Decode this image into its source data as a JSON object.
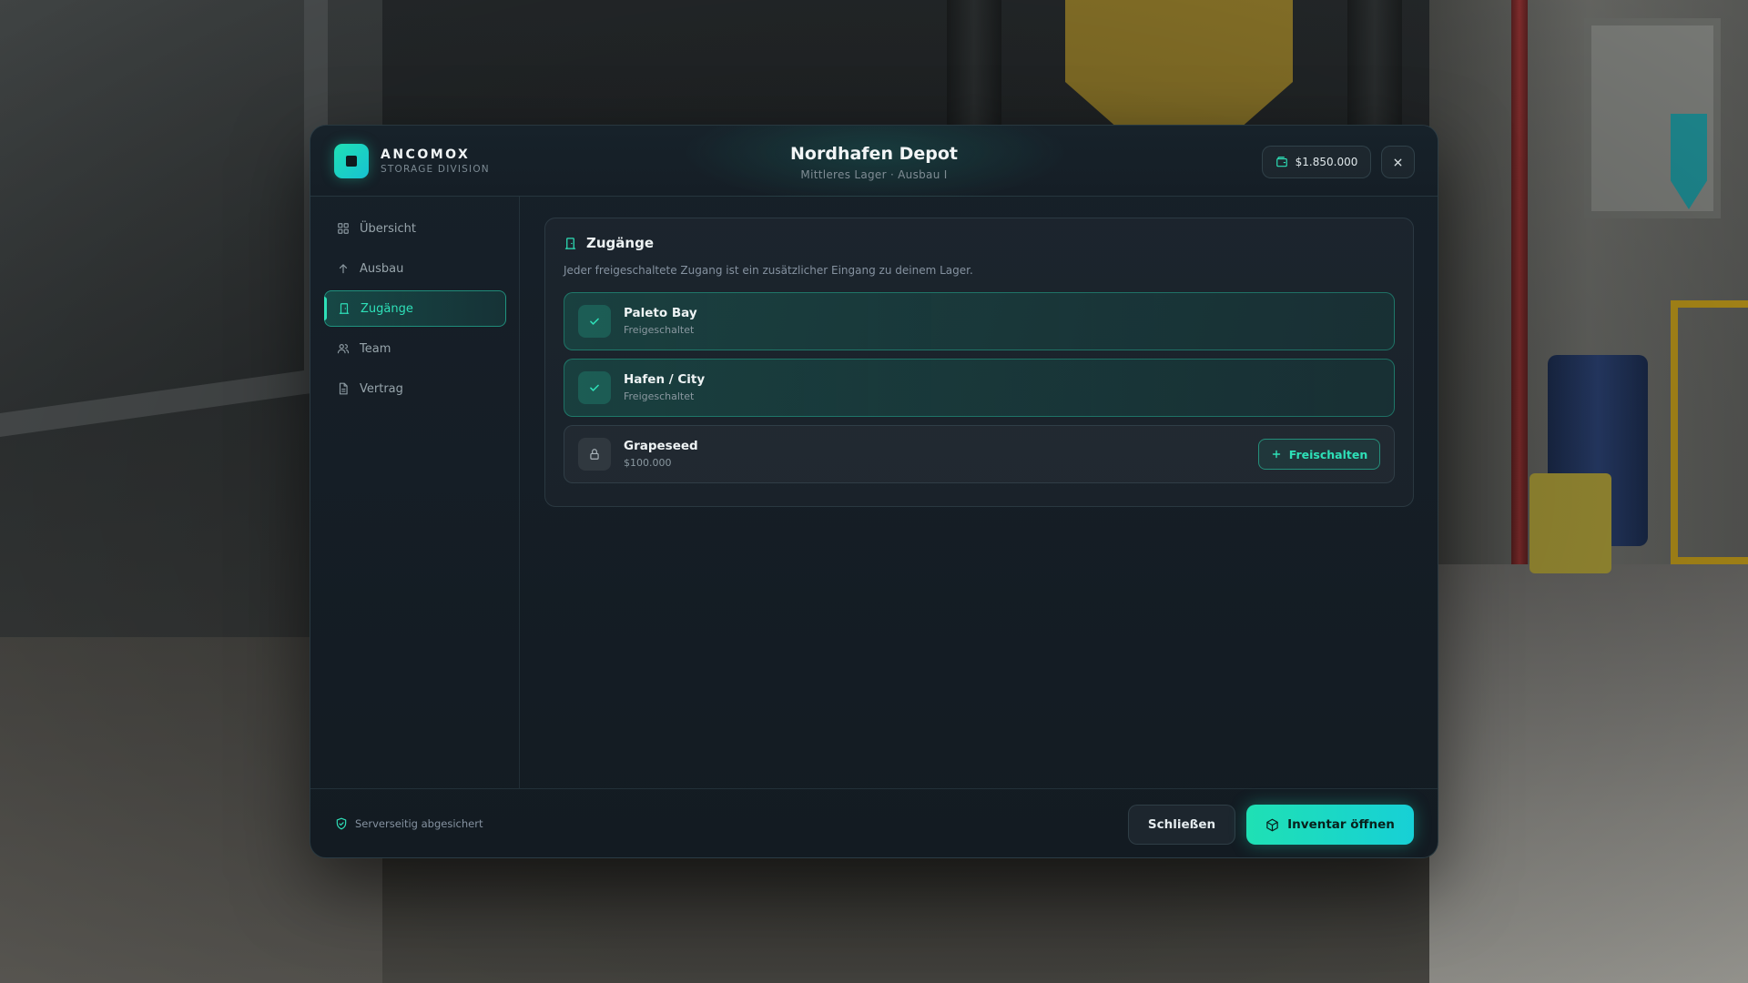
{
  "brand": {
    "name": "ANCOMOX",
    "subtitle": "STORAGE DIVISION"
  },
  "header": {
    "title": "Nordhafen Depot",
    "subtitle": "Mittleres Lager · Ausbau I",
    "balance": "$1.850.000"
  },
  "sidebar": {
    "items": [
      {
        "label": "Übersicht",
        "icon": "grid-icon"
      },
      {
        "label": "Ausbau",
        "icon": "arrow-up-icon"
      },
      {
        "label": "Zugänge",
        "icon": "door-icon",
        "active": true
      },
      {
        "label": "Team",
        "icon": "users-icon"
      },
      {
        "label": "Vertrag",
        "icon": "document-icon"
      }
    ]
  },
  "access": {
    "title": "Zugänge",
    "description": "Jeder freigeschaltete Zugang ist ein zusätzlicher Eingang zu deinem Lager.",
    "entries": [
      {
        "name": "Paleto Bay",
        "status": "Freigeschaltet",
        "unlocked": true
      },
      {
        "name": "Hafen / City",
        "status": "Freigeschaltet",
        "unlocked": true
      },
      {
        "name": "Grapeseed",
        "status": "$100.000",
        "unlocked": false,
        "action": "Freischalten"
      }
    ]
  },
  "footer": {
    "secure_note": "Serverseitig abgesichert",
    "close_label": "Schließen",
    "inventory_label": "Inventar öffnen"
  },
  "colors": {
    "accent": "#2ee0b8",
    "accent_gradient_start": "#1fe0b4",
    "accent_gradient_end": "#17d0d6",
    "panel_bg": "#151d24"
  }
}
